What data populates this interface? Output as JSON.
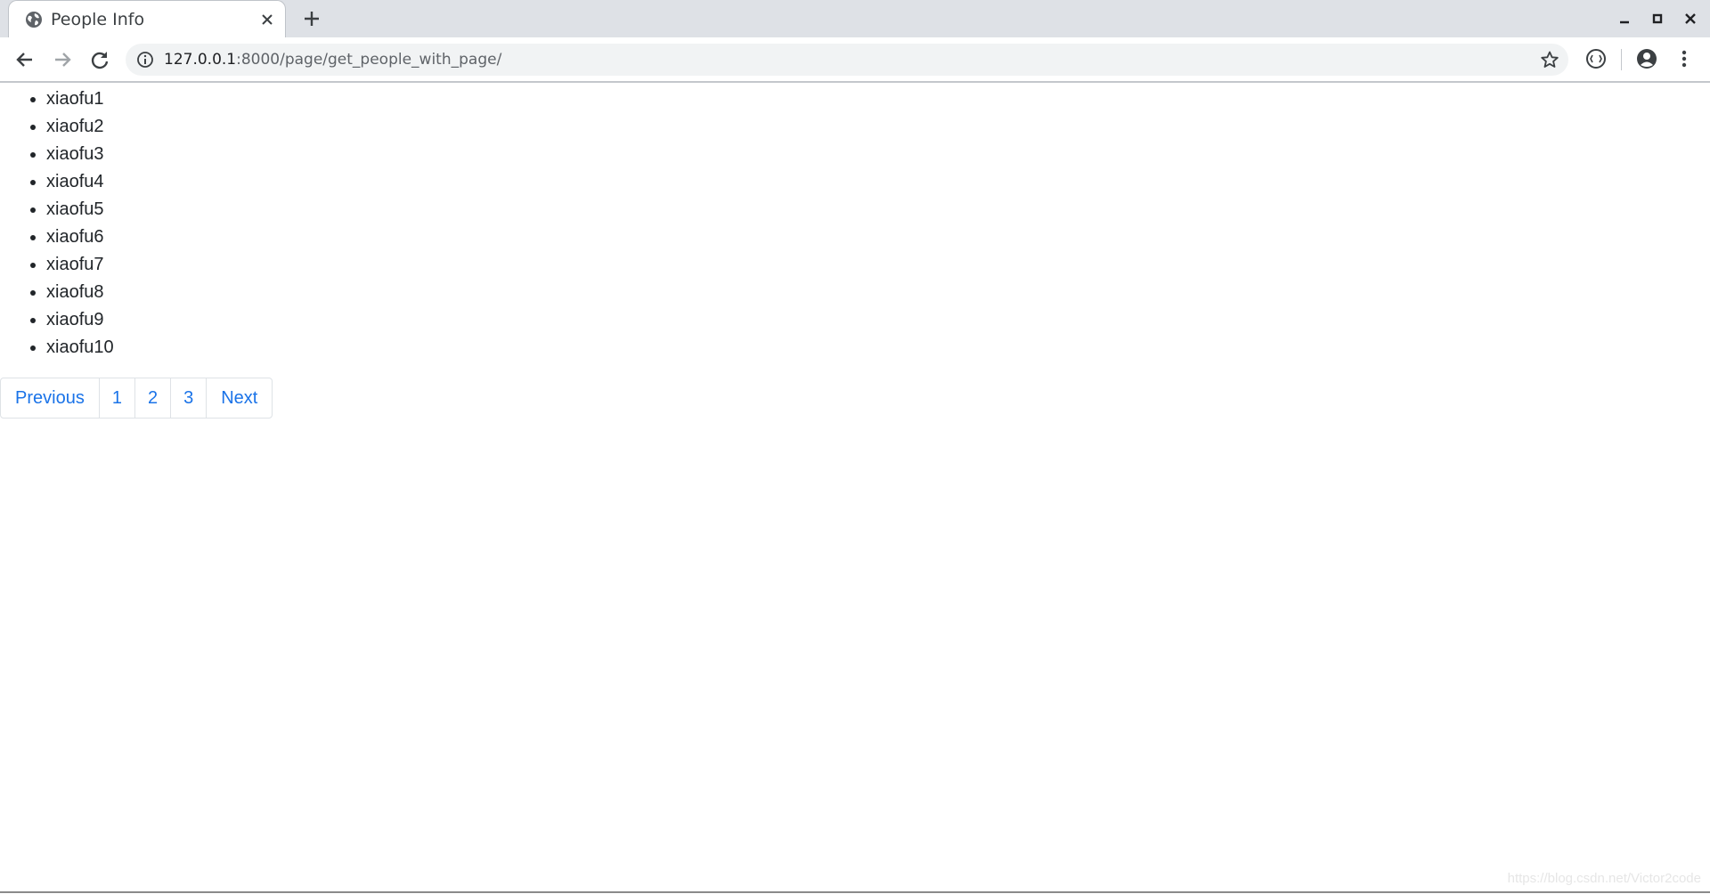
{
  "tab": {
    "title": "People Info",
    "favicon": "globe-icon"
  },
  "toolbar": {
    "url_host": "127.0.0.1",
    "url_path": ":8000/page/get_people_with_page/"
  },
  "people": [
    "xiaofu1",
    "xiaofu2",
    "xiaofu3",
    "xiaofu4",
    "xiaofu5",
    "xiaofu6",
    "xiaofu7",
    "xiaofu8",
    "xiaofu9",
    "xiaofu10"
  ],
  "pagination": {
    "previous": "Previous",
    "pages": [
      "1",
      "2",
      "3"
    ],
    "next": "Next"
  },
  "watermark": "https://blog.csdn.net/Victor2code",
  "colors": {
    "link": "#1a73e8",
    "tabstrip": "#dee1e6",
    "omnibox": "#f1f3f4"
  }
}
